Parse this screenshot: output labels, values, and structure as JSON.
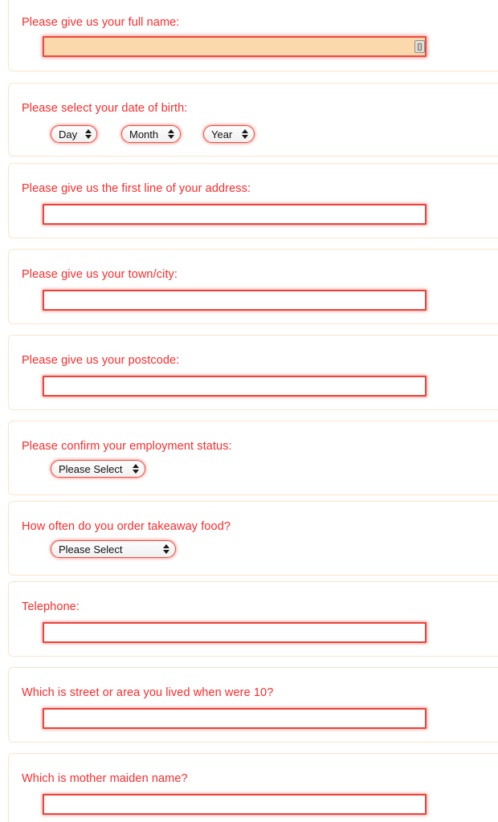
{
  "theme": {
    "label_color": "#f92c2c",
    "input_border_color": "#e8453c",
    "card_border_color": "#fae5cd",
    "autofill_background": "#fbd9ad",
    "page_background": "#ffffff"
  },
  "sections": [
    {
      "id": "full-name",
      "label": "Please give us your full name:",
      "control": "text",
      "value": "",
      "placeholder": "",
      "autofilled": true,
      "icon": "autofill-contact-card-icon"
    },
    {
      "id": "date-of-birth",
      "label": "Please select your date of birth:",
      "control": "select-group",
      "selects": [
        {
          "id": "dob-day",
          "value": "Day",
          "options": [
            "Day"
          ]
        },
        {
          "id": "dob-month",
          "value": "Month",
          "options": [
            "Month"
          ]
        },
        {
          "id": "dob-year",
          "value": "Year",
          "options": [
            "Year"
          ]
        }
      ]
    },
    {
      "id": "address-line-1",
      "label": "Please give us the first line of your address:",
      "control": "text",
      "value": "",
      "placeholder": ""
    },
    {
      "id": "town-city",
      "label": "Please give us your town/city:",
      "control": "text",
      "value": "",
      "placeholder": ""
    },
    {
      "id": "postcode",
      "label": "Please give us your postcode:",
      "control": "text",
      "value": "",
      "placeholder": ""
    },
    {
      "id": "employment-status",
      "label": "Please confirm your employment status:",
      "control": "select",
      "value": "Please Select",
      "options": [
        "Please Select"
      ]
    },
    {
      "id": "takeaway-frequency",
      "label": "How often do you order takeaway food?",
      "control": "select",
      "value": "Please Select",
      "options": [
        "Please Select"
      ]
    },
    {
      "id": "telephone",
      "label": "Telephone:",
      "control": "text",
      "value": "",
      "placeholder": ""
    },
    {
      "id": "childhood-street",
      "label": "Which is street or area you lived when were 10?",
      "control": "text",
      "value": "",
      "placeholder": ""
    },
    {
      "id": "mother-maiden-name",
      "label": "Which is mother maiden name?",
      "control": "text",
      "value": "",
      "placeholder": ""
    }
  ]
}
